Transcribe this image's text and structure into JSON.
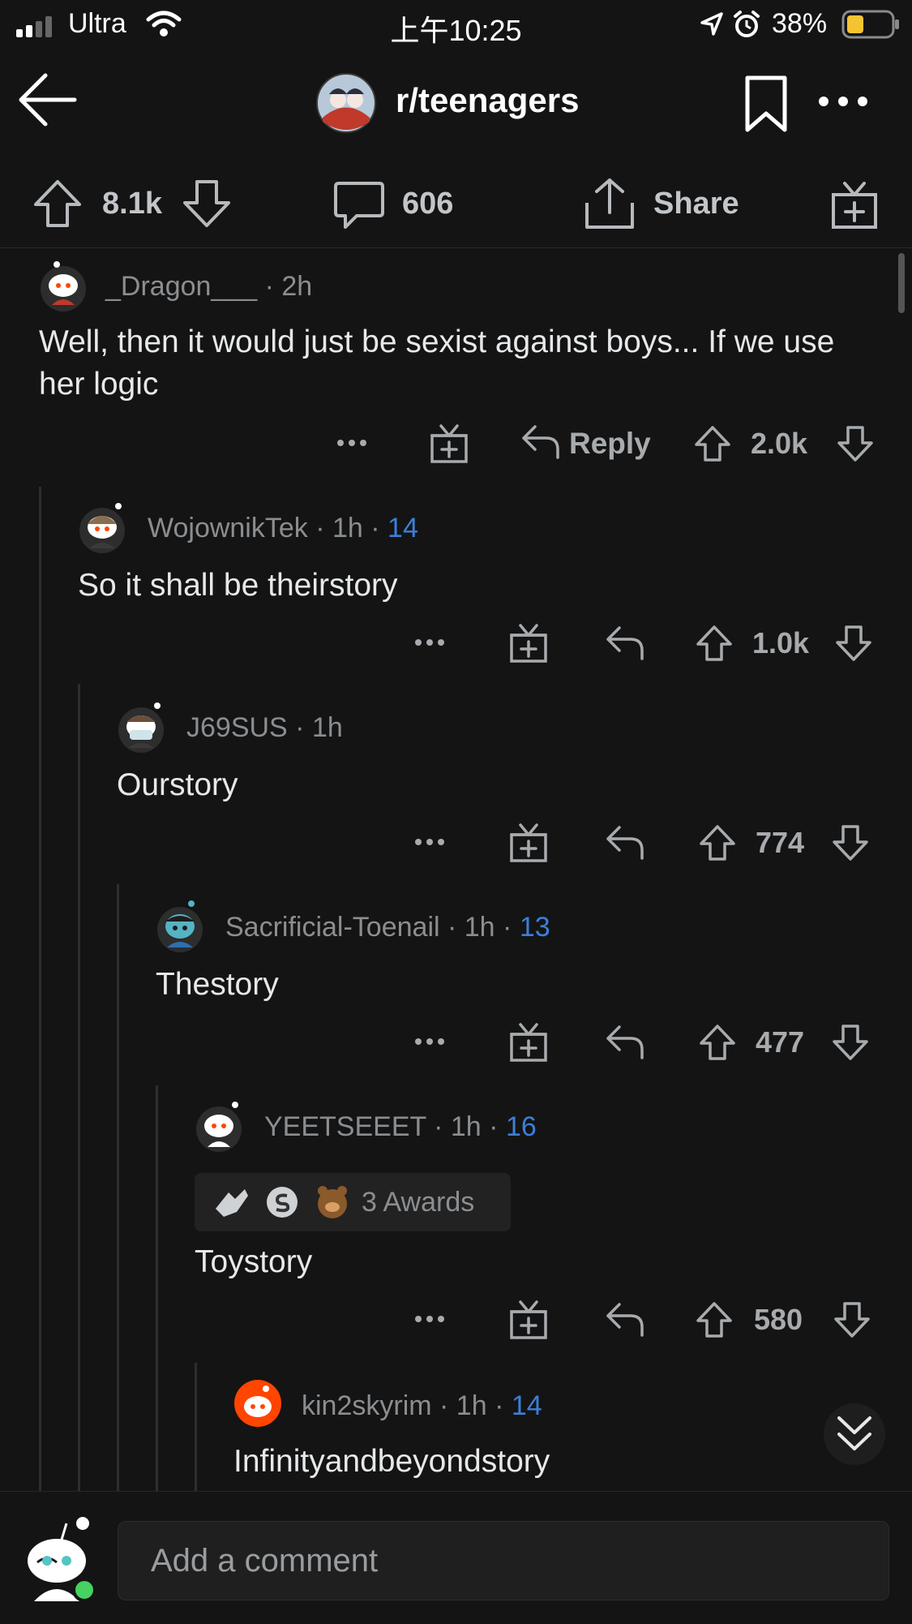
{
  "status_bar": {
    "carrier": "Ultra",
    "time": "上午10:25",
    "battery": "38%"
  },
  "header": {
    "subreddit": "r/teenagers"
  },
  "post_actions": {
    "upvotes": "8.1k",
    "comments": "606",
    "share_label": "Share"
  },
  "comments": [
    {
      "user": "_Dragon___",
      "time": "2h",
      "score": "",
      "text": "Well, then it would just be sexist against boys... If we use her logic",
      "votes": "2.0k",
      "reply_label": "Reply"
    },
    {
      "user": "WojownikTek",
      "time": "1h",
      "score": "14",
      "text": "So it shall be theirstory",
      "votes": "1.0k"
    },
    {
      "user": "J69SUS",
      "time": "1h",
      "score": "",
      "text": "Ourstory",
      "votes": "774"
    },
    {
      "user": "Sacrificial-Toenail",
      "time": "1h",
      "score": "13",
      "text": "Thestory",
      "votes": "477"
    },
    {
      "user": "YEETSEEET",
      "time": "1h",
      "score": "16",
      "awards": "3 Awards",
      "text": "Toystory",
      "votes": "580"
    },
    {
      "user": "kin2skyrim",
      "time": "1h",
      "score": "14",
      "text": "Infinityandbeyondstory"
    }
  ],
  "composer": {
    "placeholder": "Add a comment"
  },
  "colors": {
    "background": "#141414",
    "score_blue": "#3d7fd9",
    "reddit_orange": "#ff4500",
    "online_green": "#46d160"
  },
  "icons": [
    "back-arrow-icon",
    "bookmark-icon",
    "more-icon",
    "upvote-icon",
    "downvote-icon",
    "comment-icon",
    "share-icon",
    "award-icon",
    "reply-icon",
    "collapse-chevron-icon"
  ]
}
